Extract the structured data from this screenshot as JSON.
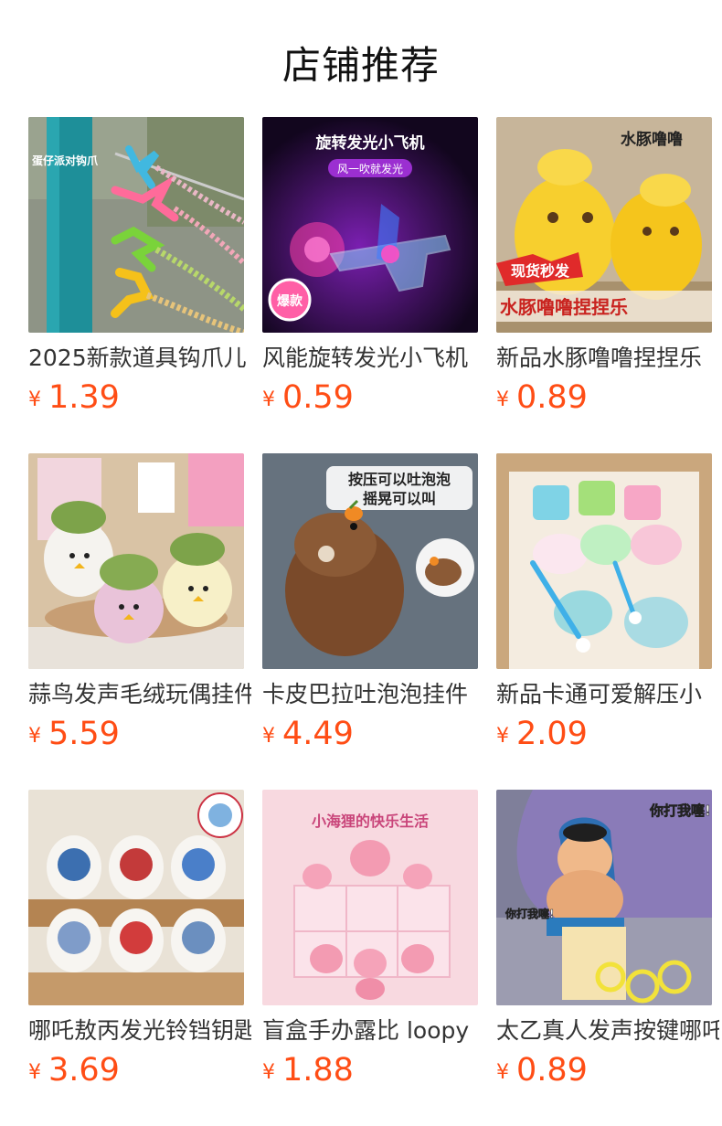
{
  "section_title": "店铺推荐",
  "currency_symbol": "¥",
  "products": [
    {
      "name": "2025新款道具钩爪儿",
      "price": "1.39",
      "image_text": [
        "蛋仔派对钩爪"
      ]
    },
    {
      "name": "风能旋转发光小飞机",
      "price": "0.59",
      "image_text": [
        "旋转发光小飞机",
        "风一吹就发光",
        "爆款"
      ]
    },
    {
      "name": "新品水豚噜噜捏捏乐",
      "price": "0.89",
      "image_text": [
        "水豚噜噜",
        "现货秒发",
        "水豚噜噜捏捏乐"
      ]
    },
    {
      "name": "蒜鸟发声毛绒玩偶挂件",
      "price": "5.59",
      "image_text": []
    },
    {
      "name": "卡皮巴拉吐泡泡挂件",
      "price": "4.49",
      "image_text": [
        "按压可以吐泡泡",
        "摇晃可以叫"
      ]
    },
    {
      "name": "新品卡通可爱解压小",
      "price": "2.09",
      "image_text": []
    },
    {
      "name": "哪吒敖丙发光铃铛钥匙",
      "price": "3.69",
      "image_text": []
    },
    {
      "name": "盲盒手办露比 loopy",
      "price": "1.88",
      "image_text": [
        "小海狸的快乐生活"
      ]
    },
    {
      "name": "太乙真人发声按键哪吒",
      "price": "0.89",
      "image_text": [
        "你打我噻!",
        "你打我噻!"
      ]
    }
  ]
}
